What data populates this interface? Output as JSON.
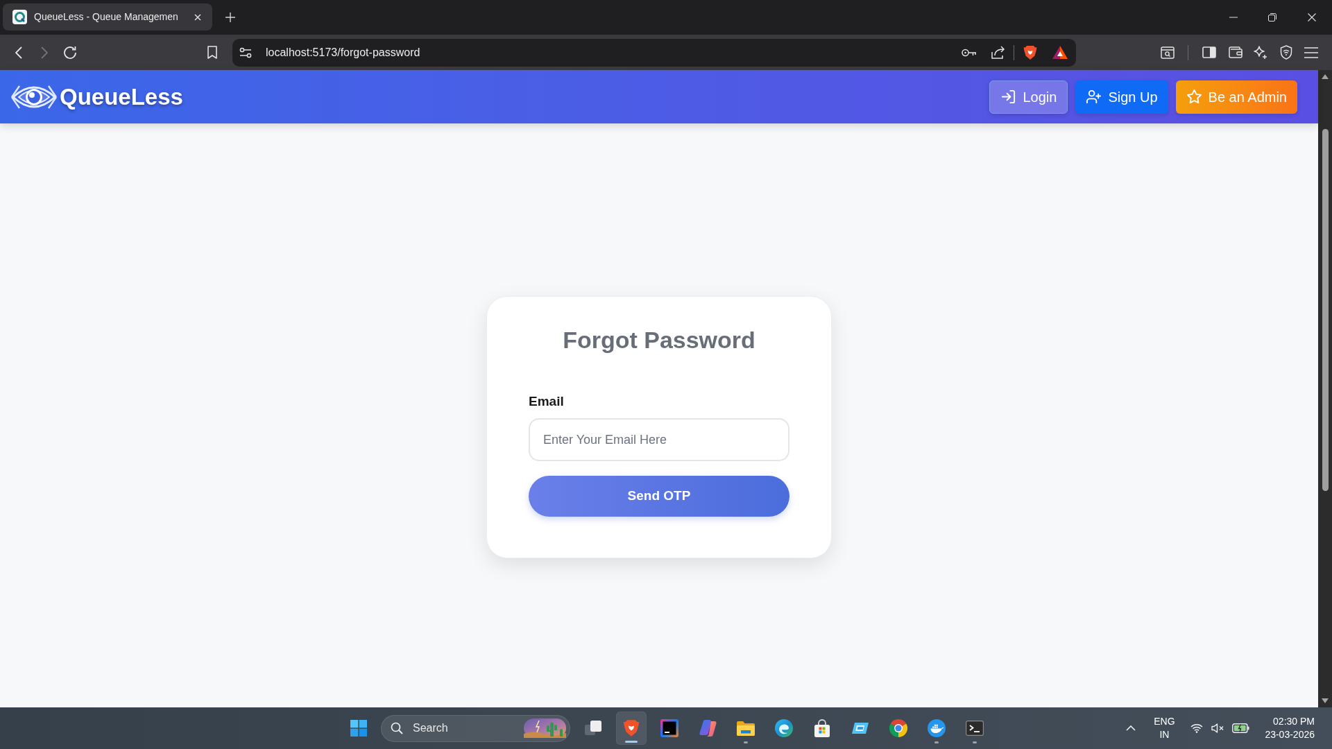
{
  "browser": {
    "tabs": [
      {
        "title": "QueueLess - Queue Managemen",
        "selected": true
      }
    ],
    "nav_buttons": [
      {
        "kind": "back",
        "disabled": false
      },
      {
        "kind": "forward",
        "disabled": true
      },
      {
        "kind": "reload",
        "disabled": false
      }
    ],
    "address": "localhost:5173/forgot-password"
  },
  "navbar": {
    "brand": "QueueLess",
    "buttons": [
      {
        "kind": "login",
        "label": "Login"
      },
      {
        "kind": "signup",
        "label": "Sign Up"
      },
      {
        "kind": "admin",
        "label": "Be an Admin"
      }
    ]
  },
  "form": {
    "title": "Forgot Password",
    "field": {
      "label": "Email",
      "placeholder": "Enter Your Email Here"
    },
    "submit": "Send OTP"
  },
  "taskbar": {
    "search": {
      "placeholder": "Search"
    },
    "apps": [
      {
        "kind": "taskview",
        "running": false,
        "selected": false
      },
      {
        "kind": "lion",
        "running": true,
        "selected": true
      },
      {
        "kind": "ide",
        "running": false,
        "selected": false
      },
      {
        "kind": "swirl",
        "running": false,
        "selected": false
      },
      {
        "kind": "folder",
        "running": true,
        "selected": false
      },
      {
        "kind": "wave",
        "running": false,
        "selected": false
      },
      {
        "kind": "bag",
        "running": false,
        "selected": false
      },
      {
        "kind": "tile",
        "running": false,
        "selected": false
      },
      {
        "kind": "wheel",
        "running": false,
        "selected": false
      },
      {
        "kind": "whale",
        "running": true,
        "selected": false
      },
      {
        "kind": "terminal",
        "running": true,
        "selected": false
      }
    ],
    "tray": {
      "language": "ENG",
      "region": "IN",
      "muted": true,
      "time": "02:30 PM",
      "date": "23-03-2026"
    }
  }
}
